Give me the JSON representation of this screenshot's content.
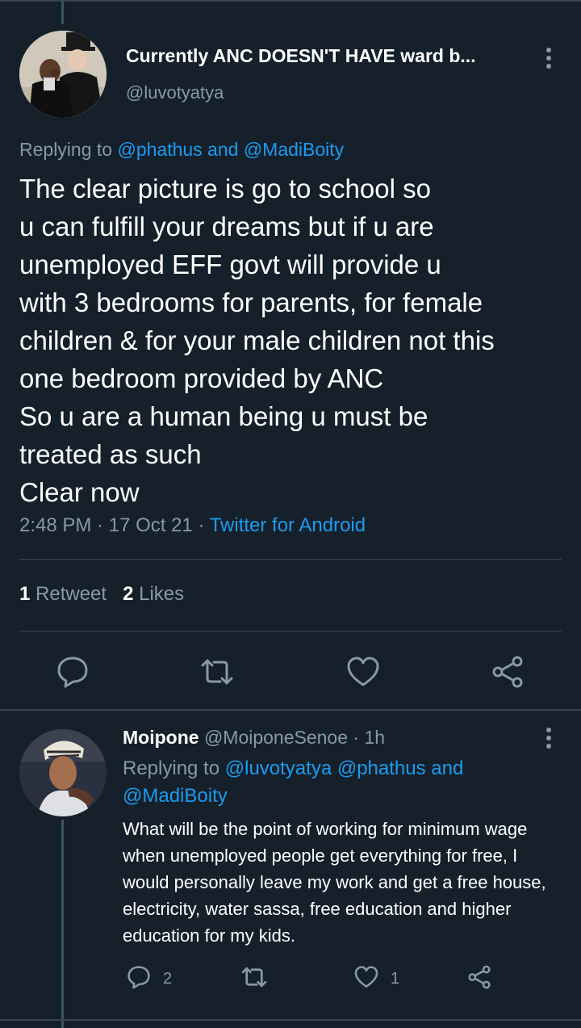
{
  "tweet": {
    "author_name": "Currently ANC DOESN'T HAVE ward b...",
    "author_handle": "@luvotyatya",
    "replying_prefix": "Replying to ",
    "reply_mention_1": "@phathus",
    "reply_joiner": " and ",
    "reply_mention_2": "@MadiBoity",
    "text": "The clear picture is go to school so\nu can fulfill your dreams but if u are\nunemployed EFF govt will provide u\nwith 3 bedrooms for parents, for female\nchildren & for your male children not this\none bedroom provided by ANC\nSo u are a human being u must be\ntreated as such\nClear now",
    "time": "2:48 PM",
    "sep": " · ",
    "date": "17 Oct 21",
    "source": "Twitter for Android",
    "retweet_count": "1",
    "retweet_label": "Retweet",
    "like_count": "2",
    "like_label": "Likes"
  },
  "actions": {
    "reply_icon": "reply-icon",
    "retweet_icon": "retweet-icon",
    "like_icon": "heart-icon",
    "share_icon": "share-icon"
  },
  "reply": {
    "name": "Moipone",
    "handle": "@MoiponeSenoe",
    "dot": " · ",
    "time": "1h",
    "replying_prefix": "Replying to ",
    "mention_1": "@luvotyatya",
    "mention_2": "@phathus",
    "joiner": " and ",
    "mention_3": "@MadiBoity",
    "text": "What will be the point of working for minimum wage when unemployed people get everything for free, I would personally leave my work and get a free house, electricity, water sassa, free education and higher education for my kids.",
    "reply_count": "2",
    "retweet_count": "",
    "like_count": "1"
  },
  "colors": {
    "background": "#15202b",
    "link": "#1d9bf0",
    "muted": "#8899a6",
    "divider": "#38444d"
  }
}
